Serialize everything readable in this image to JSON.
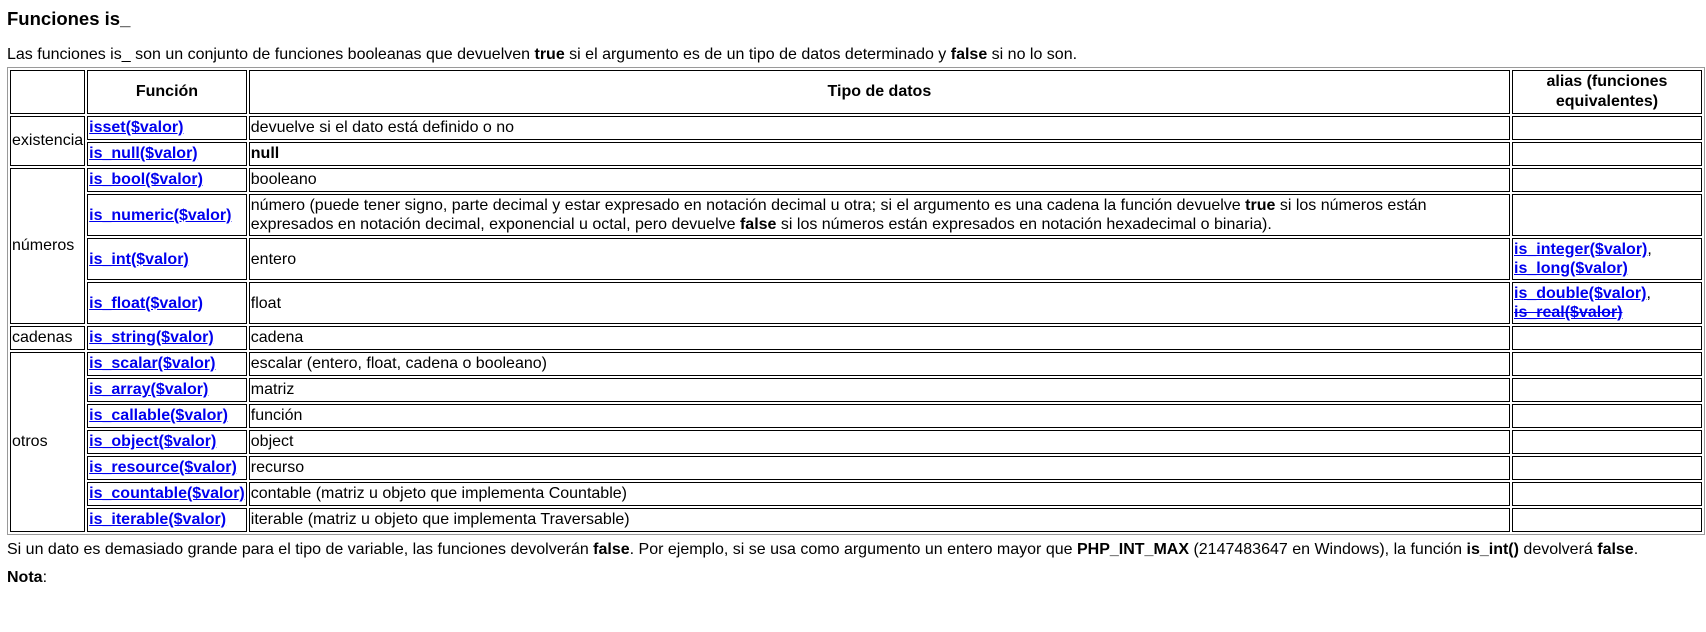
{
  "heading": "Funciones is_",
  "intro": {
    "part1": "Las funciones is_ son un conjunto de funciones booleanas que devuelven ",
    "bold1": "true",
    "part2": " si el argumento es de un tipo de datos determinado y ",
    "bold2": "false",
    "part3": " si no lo son."
  },
  "table": {
    "headers": {
      "group": "",
      "function": "Función",
      "datatype": "Tipo de datos",
      "alias": "alias (funciones equivalentes)"
    },
    "groups": {
      "existencia": "existencia",
      "numeros": "números",
      "cadenas": "cadenas",
      "otros": "otros"
    },
    "rows": {
      "isset": {
        "func": "isset($valor)",
        "type": "devuelve si el dato está definido o no"
      },
      "is_null": {
        "func": "is_null($valor)",
        "type": "null"
      },
      "is_bool": {
        "func": "is_bool($valor)",
        "type": "booleano"
      },
      "is_numeric": {
        "func": "is_numeric($valor)",
        "type_part1": "número (puede tener signo, parte decimal y estar expresado en notación decimal u otra; si el argumento es una cadena la función devuelve ",
        "type_bold1": "true",
        "type_part2": " si los números están expresados en notación decimal, exponencial u octal, pero devuelve ",
        "type_bold2": "false",
        "type_part3": " si los números están expresados en notación hexadecimal o binaria)."
      },
      "is_int": {
        "func": "is_int($valor)",
        "type": "entero",
        "alias1": "is_integer($valor)",
        "alias_sep": ",",
        "alias2": "is_long($valor)"
      },
      "is_float": {
        "func": "is_float($valor)",
        "type": "float",
        "alias1": "is_double($valor)",
        "alias_sep": ",",
        "alias2": "is_real($valor)"
      },
      "is_string": {
        "func": "is_string($valor)",
        "type": "cadena"
      },
      "is_scalar": {
        "func": "is_scalar($valor)",
        "type": "escalar (entero, float, cadena o booleano)"
      },
      "is_array": {
        "func": "is_array($valor)",
        "type": "matriz"
      },
      "is_callable": {
        "func": "is_callable($valor)",
        "type": "función"
      },
      "is_object": {
        "func": "is_object($valor)",
        "type": "object"
      },
      "is_resource": {
        "func": "is_resource($valor)",
        "type": "recurso"
      },
      "is_countable": {
        "func": "is_countable($valor)",
        "type": "contable (matriz u objeto que implementa Countable)"
      },
      "is_iterable": {
        "func": "is_iterable($valor)",
        "type": "iterable (matriz u objeto que implementa Traversable)"
      }
    }
  },
  "after": {
    "part1": "Si un dato es demasiado grande para el tipo de variable, las funciones devolverán ",
    "bold1": "false",
    "part2": ". Por ejemplo, si se usa como argumento un entero mayor que ",
    "bold2": "PHP_INT_MAX",
    "part3": " (2147483647 en Windows), la función ",
    "bold3": "is_int()",
    "part4": " devolverá ",
    "bold4": "false",
    "part5": "."
  },
  "note": {
    "label": "Nota",
    "colon": ":"
  },
  "colors": {
    "link": "#0000ee",
    "text": "#000000",
    "background": "#ffffff"
  }
}
